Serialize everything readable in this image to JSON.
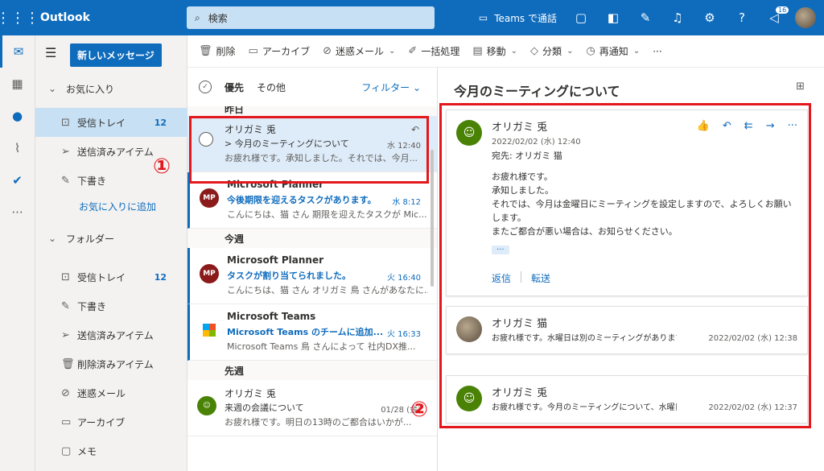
{
  "app": {
    "title": "Outlook",
    "search_placeholder": "検索",
    "teams_call": "Teams で通話",
    "notif_count": "16"
  },
  "nav": {
    "new_message": "新しいメッセージ",
    "favorites": "お気に入り",
    "fav_inbox": "受信トレイ",
    "fav_inbox_count": "12",
    "fav_sent": "送信済みアイテム",
    "fav_drafts": "下書き",
    "add_favorite": "お気に入りに追加",
    "folders": "フォルダー",
    "f_inbox": "受信トレイ",
    "f_inbox_count": "12",
    "f_drafts": "下書き",
    "f_sent": "送信済みアイテム",
    "f_deleted": "削除済みアイテム",
    "f_junk": "迷惑メール",
    "f_archive": "アーカイブ",
    "f_notes": "メモ"
  },
  "commands": {
    "delete": "削除",
    "archive": "アーカイブ",
    "junk": "迷惑メール",
    "sweep": "一括処理",
    "move": "移動",
    "categorize": "分類",
    "snooze": "再通知",
    "more": "···"
  },
  "list": {
    "tab_focused": "優先",
    "tab_other": "その他",
    "filter": "フィルター",
    "group_yesterday": "昨日",
    "group_thisweek": "今週",
    "group_lastweek": "先週",
    "messages": [
      {
        "from": "オリガミ 兎",
        "subject": "> 今月のミーティングについて",
        "preview": "お疲れ様です。承知しました。それでは、今月...",
        "time": "水 12:40"
      },
      {
        "from": "Microsoft Planner",
        "subject": "今後期限を迎えるタスクがあります。",
        "preview": "こんにちは、猫 さん 期限を迎えたタスクが Mic...",
        "time": "水 8:12",
        "initials": "MP"
      },
      {
        "from": "Microsoft Planner",
        "subject": "タスクが割り当てられました。",
        "preview": "こんにちは、猫 さん オリガミ 鳥 さんがあなたに...",
        "time": "火 16:40",
        "initials": "MP"
      },
      {
        "from": "Microsoft Teams",
        "subject": "Microsoft Teams のチームに追加...",
        "preview": "Microsoft Teams 鳥 さんによって 社内DX推...",
        "time": "火 16:33"
      },
      {
        "from": "オリガミ 兎",
        "subject": "来週の会議について",
        "preview": "お疲れ様です。明日の13時のご都合はいかが...",
        "time": "01/28 (金)"
      }
    ]
  },
  "reading": {
    "title": "今月のミーティングについて",
    "msg1": {
      "sender": "オリガミ 兎",
      "date": "2022/02/02 (水) 12:40",
      "to": "宛先: オリガミ 猫",
      "body": [
        "お疲れ様です。",
        "承知しました。",
        "それでは、今月は金曜日にミーティングを設定しますので、よろしくお願い",
        "します。",
        "またご都合が悪い場合は、お知らせください。"
      ],
      "more": "···",
      "reply": "返信",
      "forward": "転送"
    },
    "msg2": {
      "sender": "オリガミ 猫",
      "preview": "お疲れ様です。水曜日は別のミーティングがあります...",
      "date": "2022/02/02 (水) 12:38"
    },
    "msg3": {
      "sender": "オリガミ 兎",
      "preview": "お疲れ様です。今月のミーティングについて、水曜日...",
      "date": "2022/02/02 (水) 12:37"
    }
  },
  "annotations": {
    "one": "①",
    "two": "②"
  },
  "colors": {
    "brand": "#0f6cbd",
    "highlight": "#e3171c",
    "avatar_green": "#498205",
    "avatar_planner": "#8b1a1a"
  }
}
